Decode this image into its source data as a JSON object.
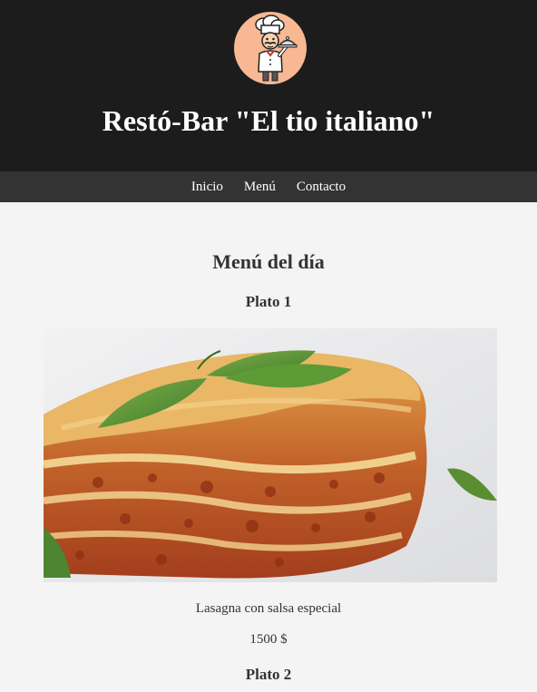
{
  "header": {
    "logo_icon": "chef-icon",
    "site_title": "Restó-Bar \"El tio italiano\"",
    "colors": {
      "background": "#1c1c1c",
      "logo_circle": "#f7b893"
    }
  },
  "nav": {
    "items": [
      {
        "label": "Inicio"
      },
      {
        "label": "Menú"
      },
      {
        "label": "Contacto"
      }
    ],
    "colors": {
      "background": "#333333",
      "text": "#ffffff"
    }
  },
  "main": {
    "section_title": "Menú del día",
    "dishes": [
      {
        "title": "Plato 1",
        "image_icon": "lasagna-image",
        "description": "Lasagna con salsa especial",
        "price": "1500 $"
      },
      {
        "title": "Plato 2"
      }
    ],
    "colors": {
      "background": "#f4f4f4",
      "text": "#333333"
    }
  }
}
